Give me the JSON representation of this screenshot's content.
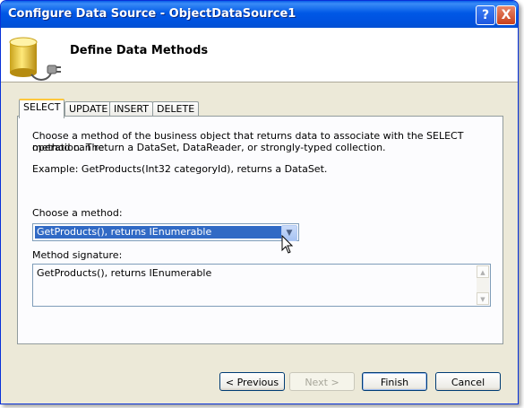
{
  "window": {
    "title": "Configure Data Source - ObjectDataSource1"
  },
  "titlebar_buttons": {
    "help": "?",
    "close": "X"
  },
  "header": {
    "title": "Define Data Methods",
    "icon": "database-plug-icon"
  },
  "tabs": [
    {
      "label": "SELECT",
      "active": true
    },
    {
      "label": "UPDATE",
      "active": false
    },
    {
      "label": "INSERT",
      "active": false
    },
    {
      "label": "DELETE",
      "active": false
    }
  ],
  "panel": {
    "description_line1": "Choose a method of the business object that returns data to associate with the SELECT operation. The",
    "description_line2": "method can return a DataSet, DataReader, or strongly-typed collection.",
    "example": "Example: GetProducts(Int32 categoryId), returns a DataSet.",
    "method_label": "Choose a method:",
    "method_selected": "GetProducts(), returns IEnumerable",
    "signature_label": "Method signature:",
    "signature_value": "GetProducts(), returns IEnumerable"
  },
  "buttons": {
    "previous": "< Previous",
    "next": "Next >",
    "finish": "Finish",
    "cancel": "Cancel"
  }
}
